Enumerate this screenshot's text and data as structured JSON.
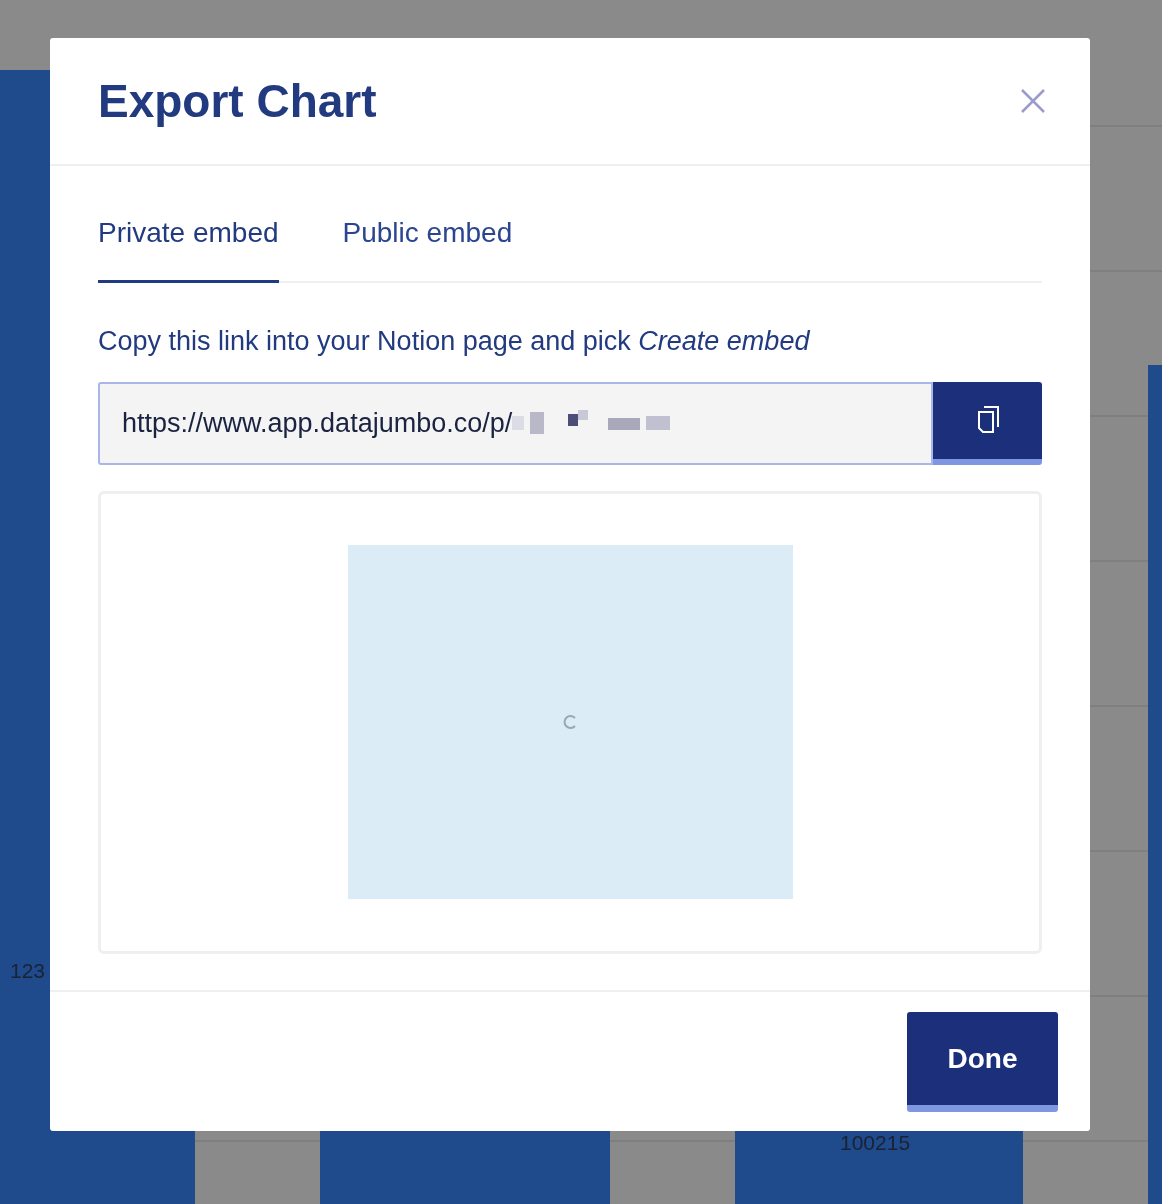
{
  "background_chart": {
    "labels": [
      {
        "text": "123"
      },
      {
        "text": "100215"
      }
    ]
  },
  "dialog": {
    "title": "Export Chart",
    "tabs": [
      {
        "label": "Private embed",
        "selected": true
      },
      {
        "label": "Public embed",
        "selected": false
      }
    ],
    "instruction": "Copy this link into your Notion page and pick *Create embed*",
    "link_field": {
      "value": "https://www.app.datajumbo.co/p/"
    },
    "preview": {
      "loading": true
    },
    "done_button": "Done"
  }
}
